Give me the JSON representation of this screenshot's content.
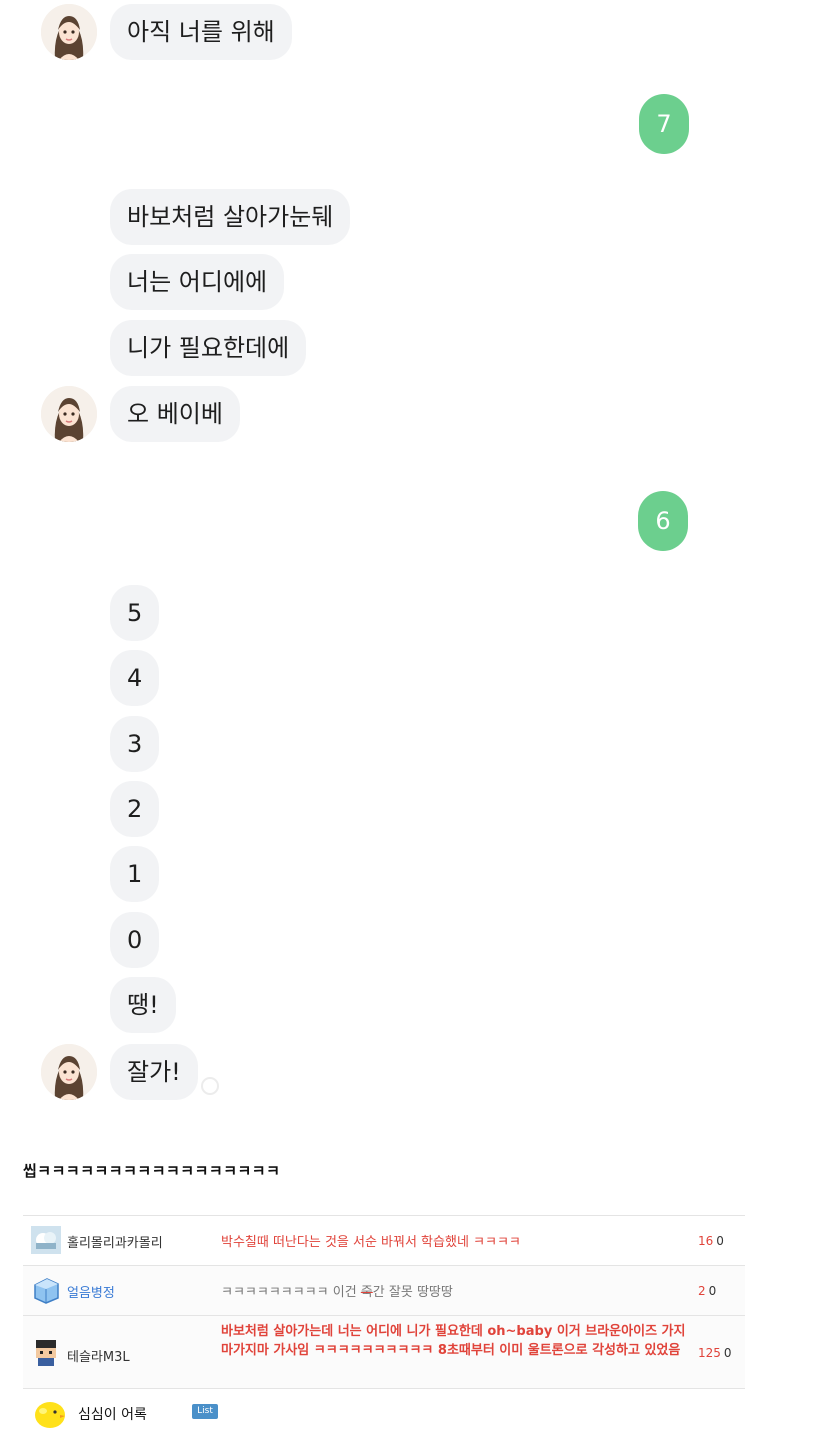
{
  "chat": {
    "messages": [
      {
        "text": "아직 너를 위해"
      },
      {
        "text": "바보처럼 살아가눈뒈"
      },
      {
        "text": "너는 어디에에"
      },
      {
        "text": "니가 필요한데에"
      },
      {
        "text": "오 베이베"
      },
      {
        "text": "5"
      },
      {
        "text": "4"
      },
      {
        "text": "3"
      },
      {
        "text": "2"
      },
      {
        "text": "1"
      },
      {
        "text": "0"
      },
      {
        "text": "땡!"
      },
      {
        "text": "잘가!"
      }
    ],
    "my_messages": [
      {
        "text": "7"
      },
      {
        "text": "6"
      }
    ],
    "my_bubble_color": "#6ccf8e",
    "bubble_color": "#f2f3f5"
  },
  "caption": "씹ㅋㅋㅋㅋㅋㅋㅋㅋㅋㅋㅋㅋㅋㅋㅋㅋㅋ",
  "comments": [
    {
      "author": "홀리몰리과카몰리",
      "text": "박수칠때 떠난다는 것을 서순 바꿔서 학습했네 ㅋㅋㅋㅋ",
      "score": "16",
      "count": "0",
      "icon": "cloud-avatar-icon"
    },
    {
      "author": "얼음병정",
      "text_before": "ㅋㅋㅋㅋㅋㅋㅋㅋㅋ 이건 ",
      "text_strike": "죽",
      "text_after": "간 잘못 땅땅땅",
      "score": "2",
      "count": "0",
      "icon": "ice-cube-icon"
    },
    {
      "author": "테슬라M3L",
      "text": "바보처럼 살아가는데 너는 어디에 니가 필요한데 oh~baby 이거 브라운아이즈 가지마가지마 가사임 ㅋㅋㅋㅋㅋㅋㅋㅋㅋㅋ 8초때부터 이미 울트론으로 각성하고 있었음",
      "score": "125",
      "count": "0",
      "icon": "pixel-character-icon"
    }
  ],
  "footer": {
    "label": "심심이 어록",
    "tag": "List",
    "icon": "chick-icon"
  }
}
